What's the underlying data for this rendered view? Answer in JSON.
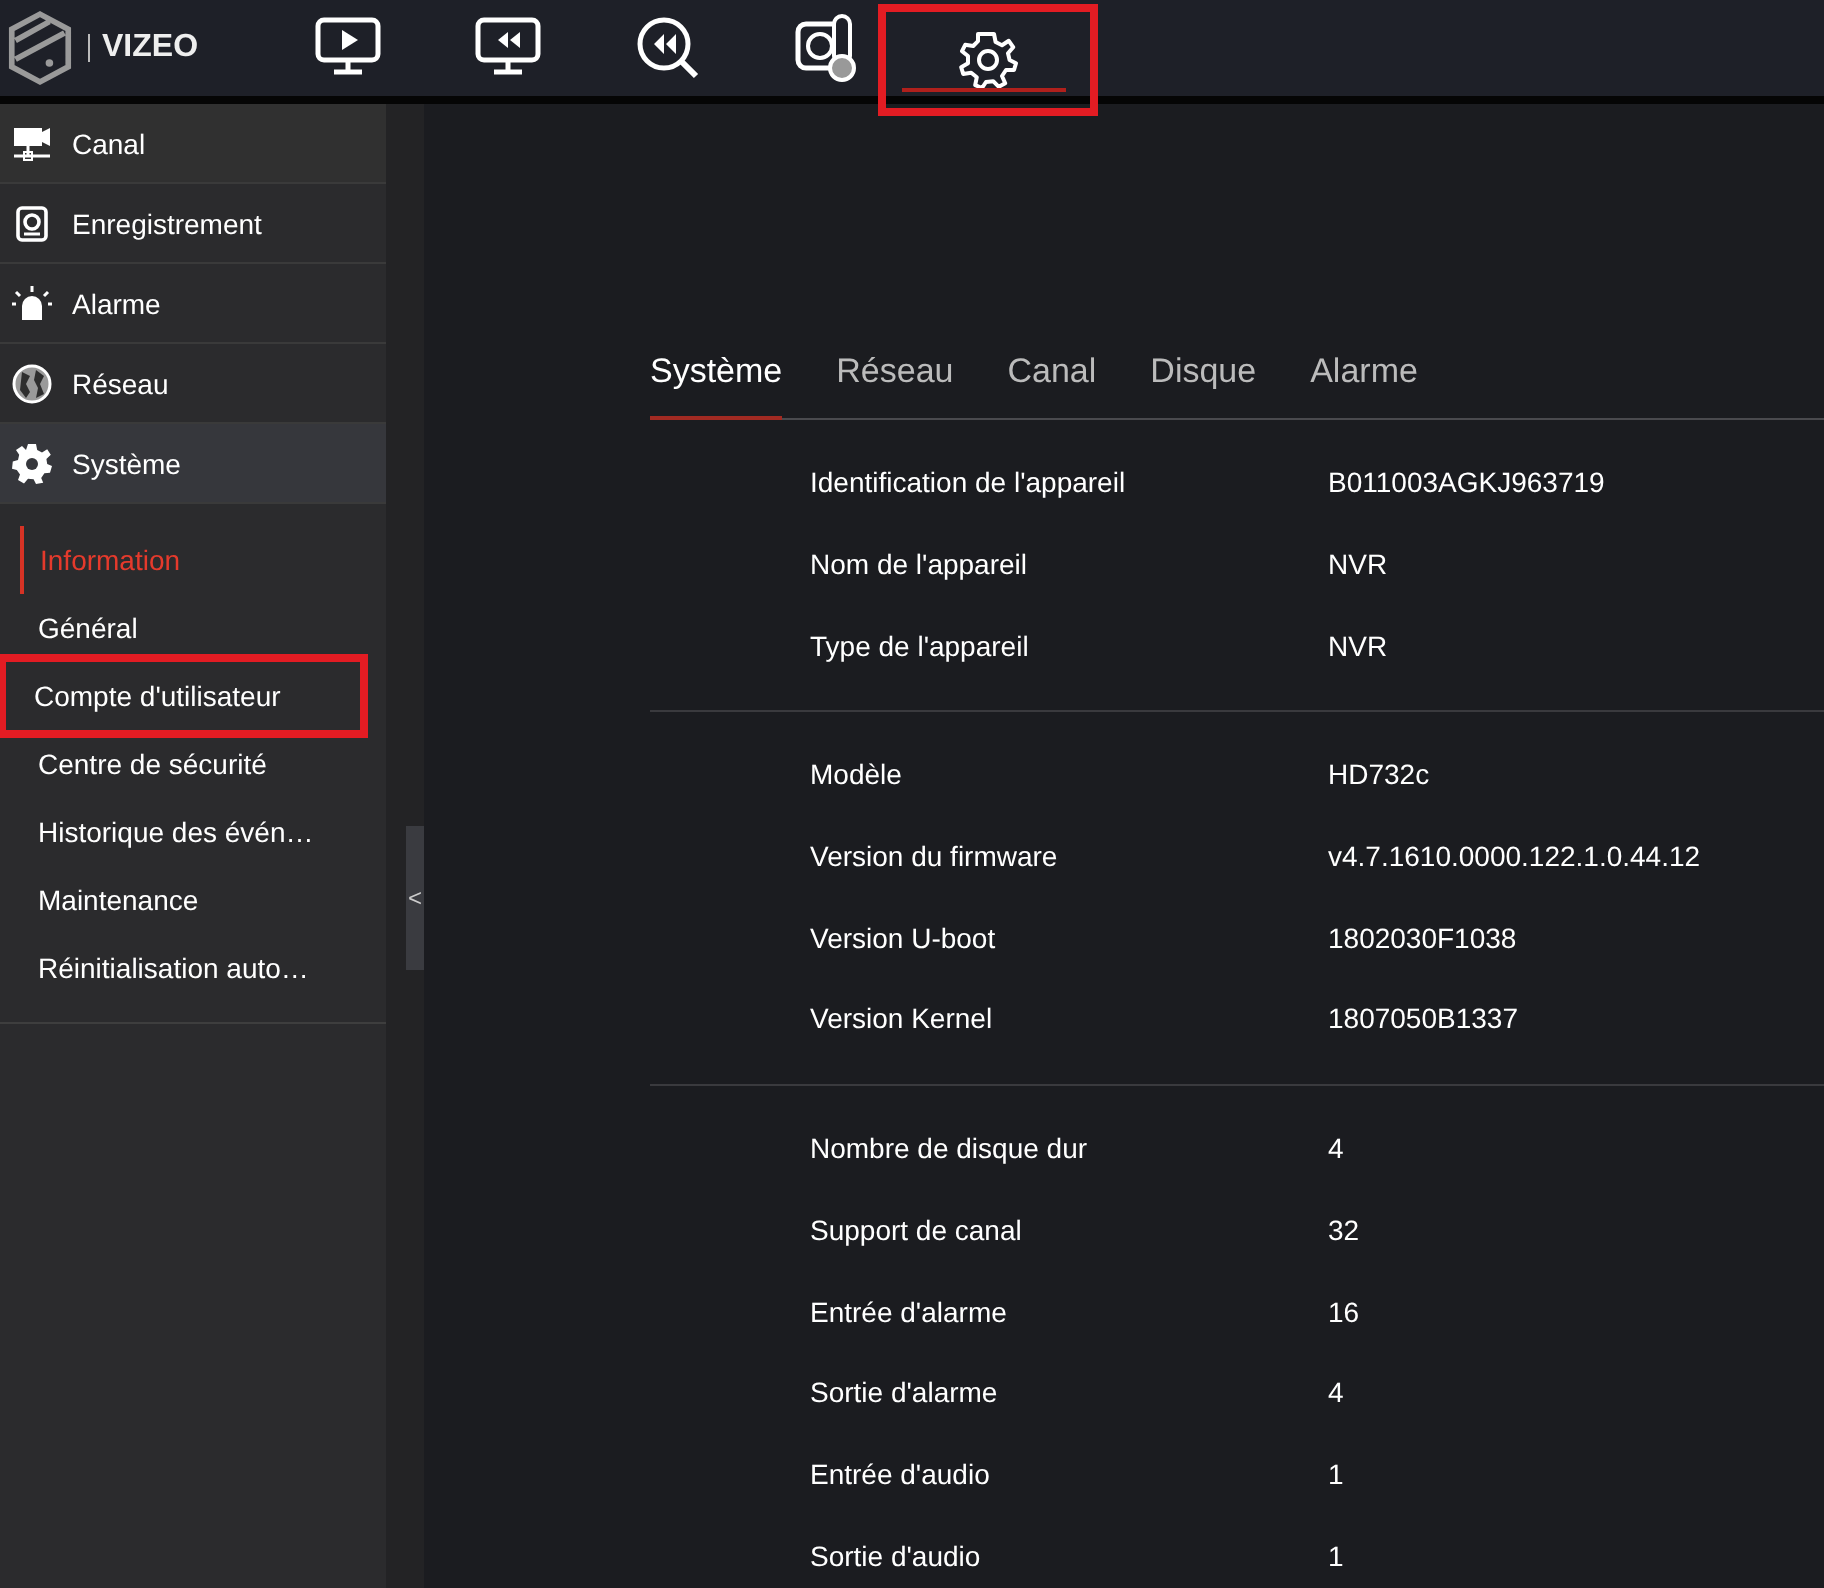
{
  "brand": "VIZEO",
  "toolbar": [
    {
      "kind": "live",
      "selected": false,
      "highlighted": false
    },
    {
      "kind": "playback",
      "selected": false,
      "highlighted": false
    },
    {
      "kind": "search",
      "selected": false,
      "highlighted": false
    },
    {
      "kind": "sensor",
      "selected": false,
      "highlighted": false
    },
    {
      "kind": "settings",
      "selected": true,
      "highlighted": true
    }
  ],
  "sidebar": {
    "items": [
      {
        "kind": "camera",
        "label": "Canal",
        "selected": false
      },
      {
        "kind": "record",
        "label": "Enregistrement",
        "selected": false
      },
      {
        "kind": "alarm",
        "label": "Alarme",
        "selected": false
      },
      {
        "kind": "globe",
        "label": "Réseau",
        "selected": false
      },
      {
        "kind": "gear",
        "label": "Système",
        "selected": true,
        "children": [
          {
            "label": "Information",
            "selected": true,
            "highlighted": false
          },
          {
            "label": "Général",
            "selected": false,
            "highlighted": false
          },
          {
            "label": "Compte d'utilisateur",
            "selected": false,
            "highlighted": true
          },
          {
            "label": "Centre de sécurité",
            "selected": false,
            "highlighted": false
          },
          {
            "label": "Historique des évén…",
            "selected": false,
            "highlighted": false
          },
          {
            "label": "Maintenance",
            "selected": false,
            "highlighted": false
          },
          {
            "label": "Réinitialisation auto…",
            "selected": false,
            "highlighted": false
          }
        ]
      }
    ]
  },
  "collapse_handle": "<",
  "tabs": [
    {
      "label": "Système",
      "selected": true
    },
    {
      "label": "Réseau",
      "selected": false
    },
    {
      "label": "Canal",
      "selected": false
    },
    {
      "label": "Disque",
      "selected": false
    },
    {
      "label": "Alarme",
      "selected": false
    }
  ],
  "info_groups": [
    [
      {
        "label": "Identification de l'appareil",
        "value": "B011003AGKJ963719"
      },
      {
        "label": "Nom de l'appareil",
        "value": "NVR"
      },
      {
        "label": "Type de l'appareil",
        "value": "NVR"
      }
    ],
    [
      {
        "label": "Modèle",
        "value": "HD732c"
      },
      {
        "label": "Version du firmware",
        "value": "v4.7.1610.0000.122.1.0.44.12"
      },
      {
        "label": "Version U-boot",
        "value": "1802030F1038"
      },
      {
        "label": "Version Kernel",
        "value": "1807050B1337"
      }
    ],
    [
      {
        "label": "Nombre de disque dur",
        "value": "4"
      },
      {
        "label": "Support de canal",
        "value": "32"
      },
      {
        "label": "Entrée d'alarme",
        "value": "16"
      },
      {
        "label": "Sortie d'alarme",
        "value": "4"
      },
      {
        "label": "Entrée d'audio",
        "value": "1"
      },
      {
        "label": "Sortie d'audio",
        "value": "1"
      }
    ]
  ]
}
